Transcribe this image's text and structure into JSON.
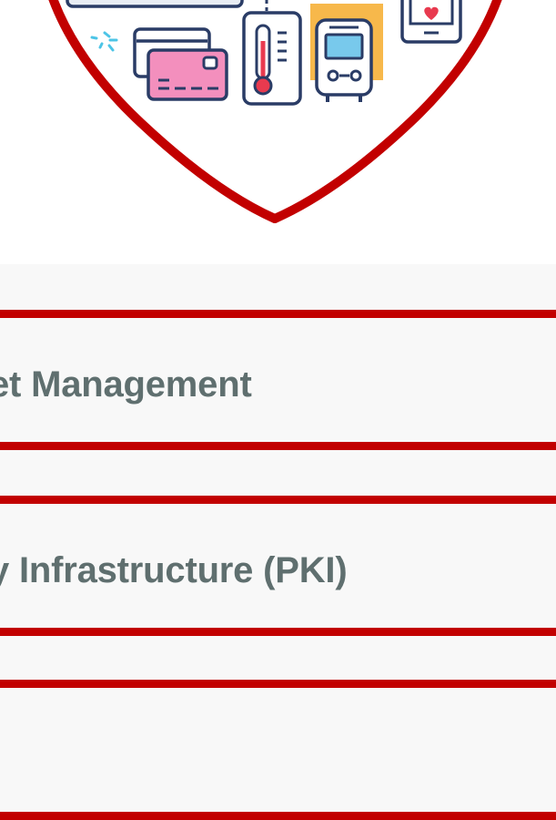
{
  "colors": {
    "accent_red": "#c20000",
    "title_gray": "#5f6f6f",
    "panel_background": "#f8f8f8",
    "page_background": "#ffffff"
  },
  "hero": {
    "icons": [
      "laptop-icon",
      "credit-card-icon",
      "thermometer-icon",
      "bus-icon",
      "smartphone-heart-icon"
    ]
  },
  "accordion": {
    "items": [
      {
        "title": "et Management"
      },
      {
        "title": "y Infrastructure (PKI)"
      },
      {
        "title": ""
      }
    ]
  }
}
